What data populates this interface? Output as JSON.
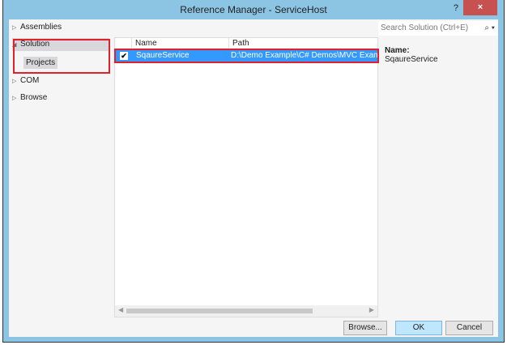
{
  "window": {
    "title": "Reference Manager - ServiceHost",
    "help": "?",
    "close": "×"
  },
  "tree": [
    {
      "label": "Assemblies",
      "expander": "▷"
    },
    {
      "label": "Solution",
      "expander": "◢",
      "child": "Projects"
    },
    {
      "label": "COM",
      "expander": "▷"
    },
    {
      "label": "Browse",
      "expander": "▷"
    }
  ],
  "list": {
    "columns": [
      "Name",
      "Path"
    ],
    "rows": [
      {
        "checked": true,
        "check": "✔",
        "name": "SqaureService",
        "path": "D:\\Demo Example\\C# Demos\\MVC Example"
      }
    ]
  },
  "search": {
    "placeholder": "Search Solution (Ctrl+E)",
    "icon": "⌕ ▾"
  },
  "details": {
    "label": "Name:",
    "value": "SqaureService"
  },
  "buttons": {
    "browse": "Browse...",
    "ok": "OK",
    "cancel": "Cancel"
  },
  "colors": {
    "selection": "#3399ff",
    "highlight": "#e0202a",
    "frame": "#8cc4e4"
  }
}
